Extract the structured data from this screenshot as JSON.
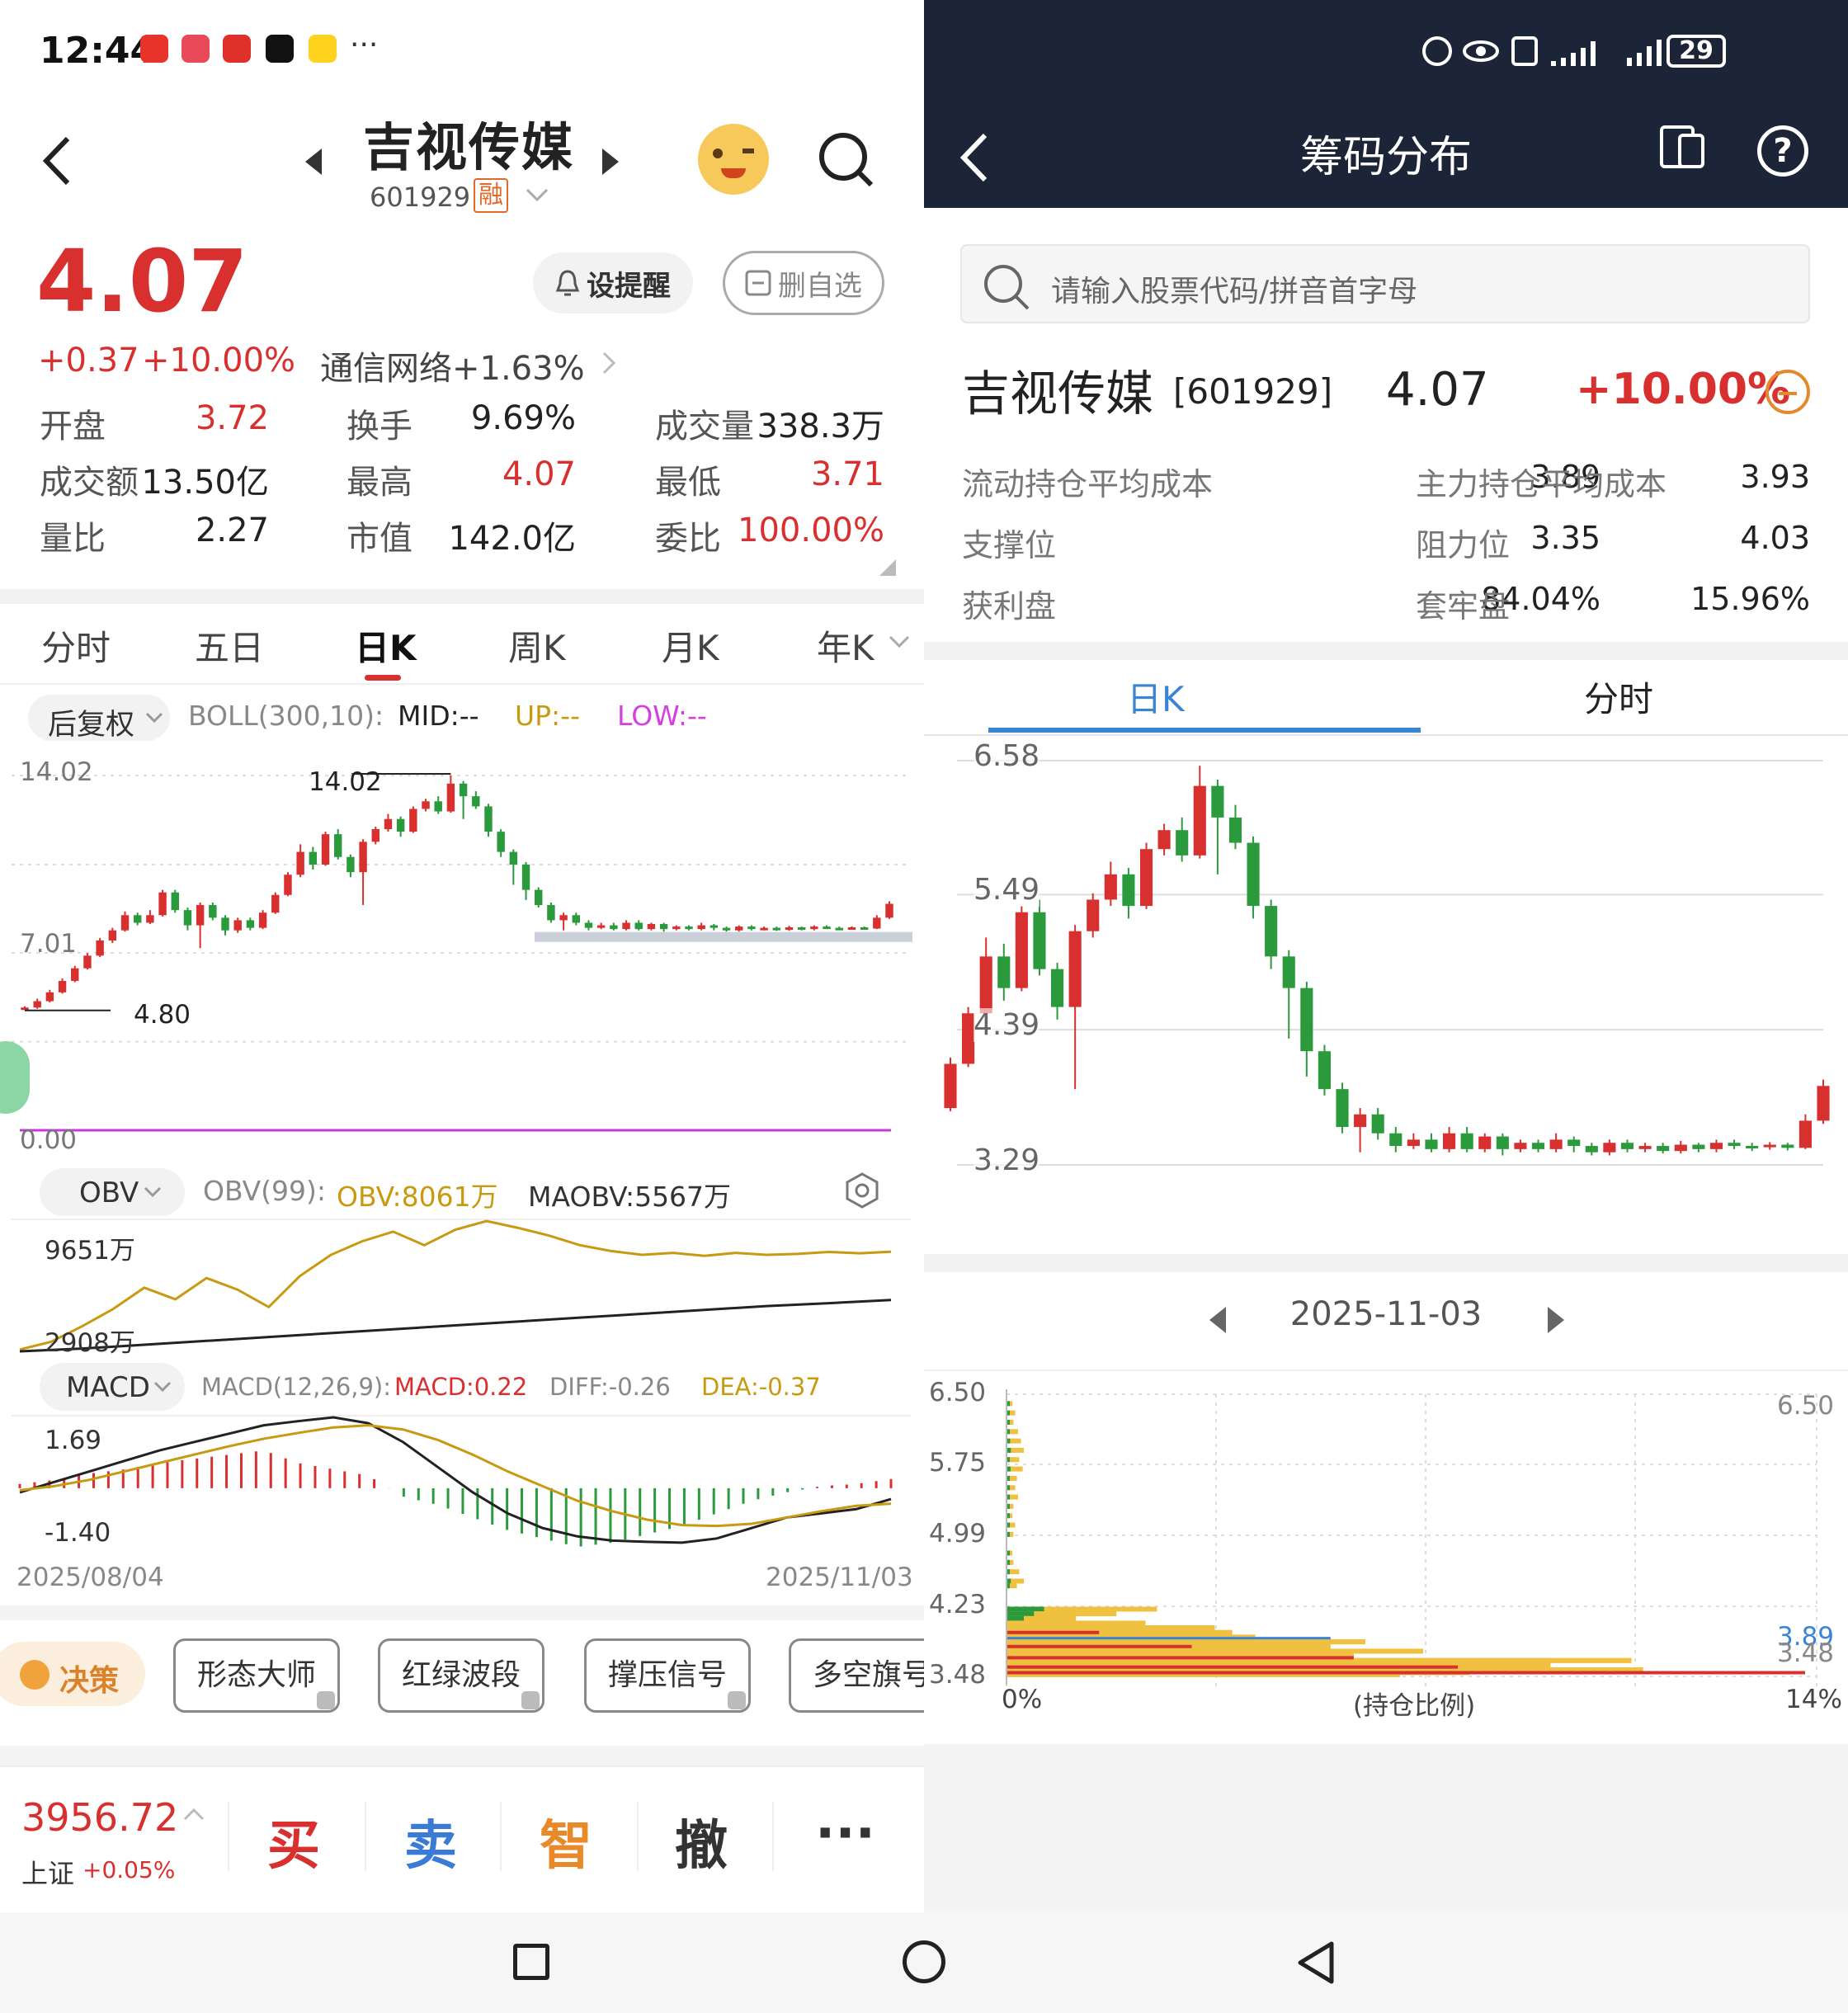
{
  "status_left": {
    "time": "12:44",
    "more": "···"
  },
  "status_right": {
    "battery": "29"
  },
  "stock": {
    "name": "吉视传媒",
    "code": "601929",
    "margin_badge": "融",
    "price": "4.07",
    "change": "+0.37",
    "change_pct": "+10.00%",
    "sector": "通信网络+1.63%",
    "alert_btn": "设提醒",
    "remove_btn": "删自选"
  },
  "quote": [
    {
      "label": "开盘",
      "value": "3.72",
      "color": "red"
    },
    {
      "label": "换手",
      "value": "9.69%",
      "color": "normal"
    },
    {
      "label": "成交量",
      "value": "338.3万",
      "color": "normal"
    },
    {
      "label": "成交额",
      "value": "13.50亿",
      "color": "normal"
    },
    {
      "label": "最高",
      "value": "4.07",
      "color": "red"
    },
    {
      "label": "最低",
      "value": "3.71",
      "color": "red"
    },
    {
      "label": "量比",
      "value": "2.27",
      "color": "normal"
    },
    {
      "label": "市值",
      "value": "142.0亿",
      "color": "normal"
    },
    {
      "label": "委比",
      "value": "100.00%",
      "color": "red"
    }
  ],
  "period_tabs": [
    "分时",
    "五日",
    "日K",
    "周K",
    "月K",
    "年K"
  ],
  "active_period": "日K",
  "kline": {
    "adjust": "后复权",
    "boll_label": "BOLL(300,10):",
    "mid": "MID:--",
    "up": "UP:--",
    "low": "LOW:--",
    "y_top": "14.02",
    "y_mid": "7.01",
    "y_bot": "0.00",
    "hi_mark": "14.02",
    "lo_mark": "4.80"
  },
  "obv": {
    "selector": "OBV",
    "label": "OBV(99):",
    "obv": "OBV:8061万",
    "maobv": "MAOBV:5567万",
    "y_top": "9651万",
    "y_bot": "2908万"
  },
  "macd": {
    "selector": "MACD",
    "label": "MACD(12,26,9):",
    "macd": "MACD:0.22",
    "diff": "DIFF:-0.26",
    "dea": "DEA:-0.37",
    "y_top": "1.69",
    "y_bot": "-1.40"
  },
  "date_range": {
    "start": "2025/08/04",
    "end": "2025/11/03"
  },
  "tools": {
    "decision": "决策",
    "items": [
      "形态大师",
      "红绿波段",
      "撑压信号",
      "多空旗号"
    ]
  },
  "bottom": {
    "index_value": "3956.72",
    "index_name": "上证",
    "index_change": "+0.05%",
    "actions": [
      "买",
      "卖",
      "智",
      "撤",
      "···"
    ]
  },
  "chip": {
    "title": "筹码分布",
    "search_placeholder": "请输入股票代码/拼音首字母",
    "name": "吉视传媒",
    "code": "[601929]",
    "price": "4.07",
    "pct": "+10.00%",
    "rows": [
      {
        "l1": "流动持仓平均成本",
        "v1": "3.89",
        "l2": "主力持仓平均成本",
        "v2": "3.93"
      },
      {
        "l1": "支撑位",
        "v1": "3.35",
        "l2": "阻力位",
        "v2": "4.03"
      },
      {
        "l1": "获利盘",
        "v1": "84.04%",
        "l2": "套牢盘",
        "v2": "15.96%"
      }
    ],
    "tabs": [
      "日K",
      "分时"
    ],
    "kline_y": [
      "6.58",
      "5.49",
      "4.39",
      "3.29"
    ],
    "date": "2025-11-03",
    "dist_y": [
      "6.50",
      "5.75",
      "4.99",
      "4.23",
      "3.48"
    ],
    "dist_right_top": "6.50",
    "dist_marks": [
      "3.89",
      "3.48"
    ],
    "dist_x": [
      "0%",
      "(持仓比例)",
      "14%"
    ]
  },
  "chart_data": {
    "type": "candlestick",
    "title": "吉视传媒 日K",
    "x_range": [
      "2025/08/04",
      "2025/11/03"
    ],
    "ylim": [
      0,
      14.02
    ],
    "annotations": {
      "high": 14.02,
      "low": 4.8
    },
    "candles": [
      [
        4.8,
        4.85,
        4.9,
        4.75
      ],
      [
        4.85,
        5.1,
        5.2,
        4.8
      ],
      [
        5.1,
        5.45,
        5.55,
        5.05
      ],
      [
        5.45,
        5.9,
        6.0,
        5.4
      ],
      [
        5.9,
        6.4,
        6.5,
        5.85
      ],
      [
        6.4,
        6.9,
        7.0,
        6.35
      ],
      [
        6.9,
        7.5,
        7.6,
        6.85
      ],
      [
        7.5,
        7.9,
        8.0,
        7.4
      ],
      [
        7.9,
        8.5,
        8.65,
        7.85
      ],
      [
        8.5,
        8.2,
        8.6,
        8.1
      ],
      [
        8.2,
        8.5,
        8.7,
        8.15
      ],
      [
        8.5,
        9.4,
        9.5,
        8.45
      ],
      [
        9.4,
        8.7,
        9.5,
        8.6
      ],
      [
        8.7,
        8.1,
        8.8,
        7.9
      ],
      [
        8.1,
        8.9,
        9.0,
        7.2
      ],
      [
        8.9,
        8.4,
        9.0,
        8.3
      ],
      [
        8.4,
        7.9,
        8.5,
        7.7
      ],
      [
        7.9,
        8.3,
        8.4,
        7.8
      ],
      [
        8.3,
        8.0,
        8.4,
        7.9
      ],
      [
        8.0,
        8.6,
        8.7,
        7.95
      ],
      [
        8.6,
        9.3,
        9.4,
        8.55
      ],
      [
        9.3,
        10.1,
        10.2,
        9.25
      ],
      [
        10.1,
        11.0,
        11.3,
        10.0
      ],
      [
        11.0,
        10.5,
        11.2,
        10.3
      ],
      [
        10.5,
        11.7,
        11.8,
        10.45
      ],
      [
        11.7,
        10.8,
        11.9,
        10.7
      ],
      [
        10.8,
        10.2,
        10.9,
        10.0
      ],
      [
        10.2,
        11.4,
        11.5,
        8.9
      ],
      [
        11.4,
        11.9,
        12.0,
        11.3
      ],
      [
        11.9,
        12.3,
        12.5,
        11.8
      ],
      [
        12.3,
        11.8,
        12.4,
        11.6
      ],
      [
        11.8,
        12.7,
        12.8,
        11.75
      ],
      [
        12.7,
        13.0,
        13.1,
        12.6
      ],
      [
        13.0,
        12.6,
        13.2,
        12.5
      ],
      [
        12.6,
        13.7,
        14.02,
        12.55
      ],
      [
        13.7,
        13.2,
        13.8,
        12.3
      ],
      [
        13.2,
        12.8,
        13.4,
        12.7
      ],
      [
        12.8,
        11.8,
        12.9,
        11.6
      ],
      [
        11.8,
        11.0,
        11.9,
        10.8
      ],
      [
        11.0,
        10.5,
        11.1,
        9.7
      ],
      [
        10.5,
        9.5,
        10.6,
        9.1
      ],
      [
        9.5,
        8.9,
        9.6,
        8.8
      ],
      [
        8.9,
        8.3,
        9.0,
        8.2
      ],
      [
        8.3,
        8.5,
        8.6,
        7.9
      ],
      [
        8.5,
        8.2,
        8.6,
        8.1
      ],
      [
        8.2,
        8.0,
        8.3,
        7.9
      ],
      [
        8.0,
        8.1,
        8.2,
        7.95
      ],
      [
        8.1,
        7.95,
        8.2,
        7.9
      ],
      [
        7.95,
        8.2,
        8.3,
        7.9
      ],
      [
        8.2,
        7.95,
        8.3,
        7.9
      ],
      [
        7.95,
        8.15,
        8.2,
        7.9
      ],
      [
        8.15,
        7.95,
        8.2,
        7.85
      ],
      [
        7.95,
        8.05,
        8.1,
        7.9
      ],
      [
        8.05,
        7.95,
        8.1,
        7.9
      ],
      [
        7.95,
        8.1,
        8.2,
        7.9
      ],
      [
        8.1,
        8.0,
        8.15,
        7.9
      ],
      [
        8.0,
        7.9,
        8.05,
        7.85
      ],
      [
        7.9,
        8.05,
        8.1,
        7.85
      ],
      [
        8.05,
        7.95,
        8.1,
        7.9
      ],
      [
        7.95,
        8.0,
        8.05,
        7.9
      ],
      [
        8.0,
        7.92,
        8.05,
        7.88
      ],
      [
        7.92,
        8.02,
        8.08,
        7.88
      ],
      [
        8.02,
        7.95,
        8.05,
        7.9
      ],
      [
        7.95,
        8.05,
        8.1,
        7.9
      ],
      [
        8.05,
        8.0,
        8.1,
        7.95
      ],
      [
        8.0,
        7.98,
        8.05,
        7.92
      ],
      [
        7.98,
        8.02,
        8.06,
        7.94
      ],
      [
        8.02,
        7.97,
        8.05,
        7.93
      ],
      [
        7.97,
        8.4,
        8.5,
        7.95
      ],
      [
        8.4,
        8.95,
        9.05,
        8.35
      ]
    ],
    "obv_series": [
      3000,
      3400,
      4200,
      5100,
      6200,
      5600,
      6700,
      6100,
      5200,
      6800,
      7900,
      8600,
      9100,
      8400,
      9200,
      9651,
      9300,
      8900,
      8400,
      8100,
      7900,
      8000,
      7850,
      8000,
      7900,
      7950,
      8050,
      7980,
      8061
    ],
    "maobv_series": [
      2908,
      3050,
      3250,
      3450,
      3650,
      3850,
      4050,
      4250,
      4450,
      4650,
      4850,
      5050,
      5250,
      5400,
      5567
    ],
    "macd_diff": [
      -0.1,
      0.15,
      0.4,
      0.65,
      0.9,
      1.1,
      1.3,
      1.5,
      1.6,
      1.69,
      1.55,
      1.1,
      0.5,
      -0.1,
      -0.6,
      -0.95,
      -1.15,
      -1.25,
      -1.28,
      -1.3,
      -1.2,
      -0.95,
      -0.7,
      -0.6,
      -0.5,
      -0.26
    ],
    "macd_dea": [
      -0.05,
      0.05,
      0.2,
      0.4,
      0.6,
      0.8,
      1.0,
      1.18,
      1.32,
      1.45,
      1.5,
      1.4,
      1.15,
      0.8,
      0.4,
      0.05,
      -0.3,
      -0.55,
      -0.75,
      -0.88,
      -0.9,
      -0.85,
      -0.7,
      -0.55,
      -0.42,
      -0.37
    ],
    "macd_hist": [
      0.1,
      0.2,
      0.35,
      0.45,
      0.6,
      0.7,
      0.8,
      0.9,
      0.6,
      0.45,
      0.3,
      -0.2,
      -0.4,
      -0.7,
      -1.0,
      -1.2,
      -1.4,
      -1.3,
      -1.1,
      -0.9,
      -0.6,
      -0.3,
      -0.1,
      0.05,
      0.1,
      0.22
    ],
    "chip_distribution": {
      "price_levels": [
        6.5,
        5.75,
        4.99,
        4.23,
        3.48
      ],
      "avg_cost": 3.89,
      "max_pct": "14%"
    }
  }
}
